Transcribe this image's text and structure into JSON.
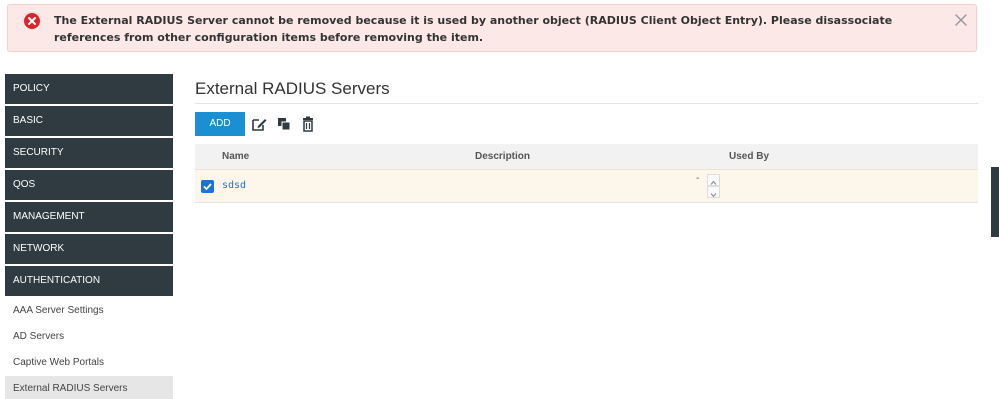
{
  "alert": {
    "message": "The External RADIUS Server cannot be removed because it is used by another object (RADIUS Client Object Entry). Please disassociate references from other configuration items before removing the item.",
    "color": "#d9262c"
  },
  "sidebar": {
    "items": [
      {
        "label": "POLICY"
      },
      {
        "label": "BASIC"
      },
      {
        "label": "SECURITY"
      },
      {
        "label": "QOS"
      },
      {
        "label": "MANAGEMENT"
      },
      {
        "label": "NETWORK"
      },
      {
        "label": "AUTHENTICATION"
      }
    ],
    "sub_items": [
      {
        "label": "AAA Server Settings"
      },
      {
        "label": "AD Servers"
      },
      {
        "label": "Captive Web Portals"
      },
      {
        "label": "External RADIUS Servers"
      }
    ]
  },
  "main": {
    "title": "External RADIUS Servers",
    "toolbar": {
      "add_label": "ADD",
      "icons": [
        "edit-icon",
        "clone-icon",
        "delete-icon"
      ]
    },
    "table": {
      "columns": [
        "Name",
        "Description",
        "Used By"
      ],
      "rows": [
        {
          "name": "sdsd",
          "description": "-",
          "used_by": ""
        }
      ]
    }
  },
  "colors": {
    "accent": "#1a8fd1",
    "nav_bg": "#2f3b40",
    "selected_row": "#fdf6ea",
    "alert_bg": "#fde8e8"
  }
}
